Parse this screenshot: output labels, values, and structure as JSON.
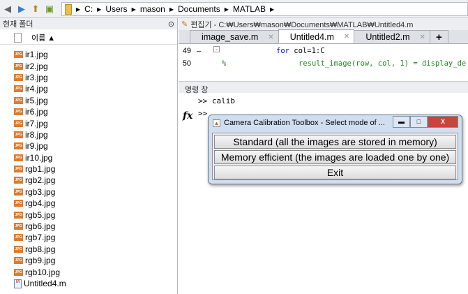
{
  "toolbar": {
    "path": [
      "C:",
      "Users",
      "mason",
      "Documents",
      "MATLAB"
    ]
  },
  "current_folder": {
    "title": "현재 폴더",
    "column": "이름 ▲",
    "files": [
      "ir1.jpg",
      "ir2.jpg",
      "ir3.jpg",
      "ir4.jpg",
      "ir5.jpg",
      "ir6.jpg",
      "ir7.jpg",
      "ir8.jpg",
      "ir9.jpg",
      "ir10.jpg",
      "rgb1.jpg",
      "rgb2.jpg",
      "rgb3.jpg",
      "rgb4.jpg",
      "rgb5.jpg",
      "rgb6.jpg",
      "rgb7.jpg",
      "rgb8.jpg",
      "rgb9.jpg",
      "rgb10.jpg"
    ],
    "mfile": "Untitled4.m"
  },
  "editor": {
    "title": "편집기 - C:₩Users₩mason₩Documents₩MATLAB₩Untitled4.m",
    "tabs": [
      "image_save.m",
      "Untitled4.m",
      "Untitled2.m"
    ],
    "plus": "+",
    "lines": [
      {
        "n": "49",
        "mark": "–",
        "kw": "for",
        "text": " col=1:C"
      },
      {
        "n": "50",
        "mark": "%",
        "text": "result_image(row, col, 1) = display_de"
      }
    ]
  },
  "command": {
    "title": "명령 창",
    "line1": ">> calib",
    "prompt": ">>",
    "fx": "fx"
  },
  "dialog": {
    "title": "Camera Calibration Toolbox - Select mode of ...",
    "buttons": [
      "Standard (all the images are stored in memory)",
      "Memory efficient (the images are loaded one by one)",
      "Exit"
    ]
  }
}
